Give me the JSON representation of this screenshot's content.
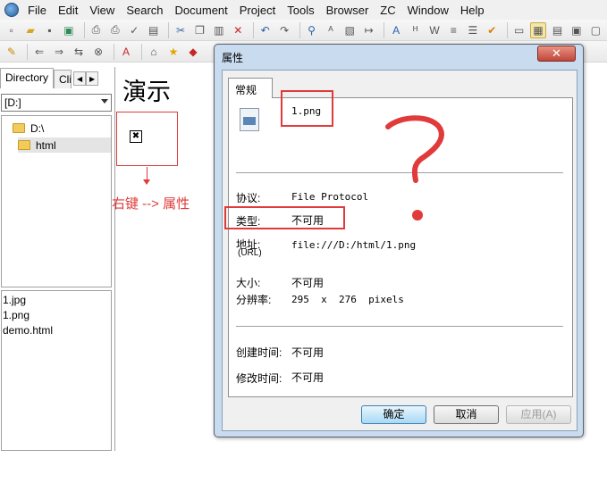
{
  "menubar": {
    "items": [
      "File",
      "Edit",
      "View",
      "Search",
      "Document",
      "Project",
      "Tools",
      "Browser",
      "ZC",
      "Window",
      "Help"
    ]
  },
  "left_panel": {
    "tabs": [
      "Directory",
      "Cli"
    ],
    "drive": "[D:]",
    "tree": [
      "D:\\",
      "html"
    ],
    "files": [
      "1.jpg",
      "1.png",
      "demo.html"
    ]
  },
  "editor": {
    "title": "演示",
    "broken_image_glyph": "✖",
    "annotation": "右键 --> 属性"
  },
  "dialog": {
    "title": "属性",
    "close": "✕",
    "tab": "常规",
    "filename": "1.png",
    "protocol_label": "协议:",
    "protocol_value": "File Protocol",
    "type_label": "类型:",
    "type_value": "不可用",
    "address_label": "地址:",
    "address_sub": "(URL)",
    "address_value": "file:///D:/html/1.png",
    "size_label": "大小:",
    "size_value": "不可用",
    "resolution_label": "分辨率:",
    "resolution_value": "295  x  276  pixels",
    "created_label": "创建时间:",
    "created_value": "不可用",
    "modified_label": "修改时间:",
    "modified_value": "不可用",
    "ok": "确定",
    "cancel": "取消",
    "apply": "应用(A)"
  },
  "colors": {
    "annotation_red": "#e03a3a",
    "dialog_frame": "#c9dbee"
  }
}
